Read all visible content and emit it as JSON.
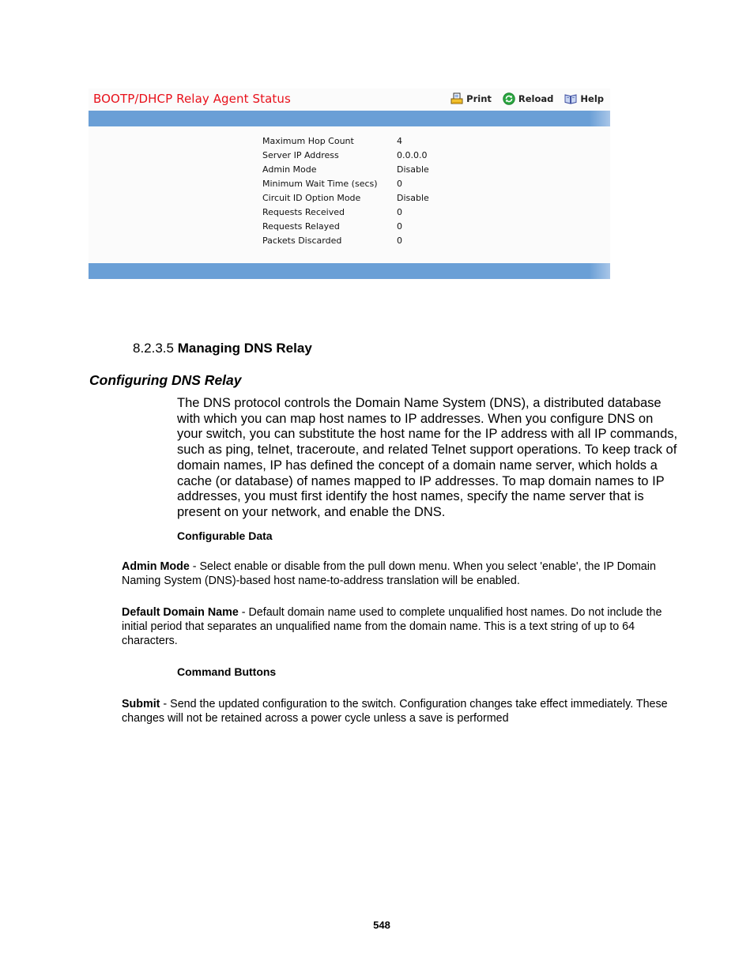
{
  "ui": {
    "title": "BOOTP/DHCP Relay Agent Status",
    "toolbar": {
      "print": {
        "label": "Print",
        "icon": "printer-icon"
      },
      "reload": {
        "label": "Reload",
        "icon": "reload-icon"
      },
      "help": {
        "label": "Help",
        "icon": "book-icon"
      }
    },
    "colors": {
      "title": "#e8101a",
      "bar": "#6a9fd6"
    },
    "rows": [
      {
        "label": "Maximum Hop Count",
        "value": "4"
      },
      {
        "label": "Server IP Address",
        "value": "0.0.0.0"
      },
      {
        "label": "Admin Mode",
        "value": "Disable"
      },
      {
        "label": "Minimum Wait Time (secs)",
        "value": "0"
      },
      {
        "label": "Circuit ID Option Mode",
        "value": "Disable"
      },
      {
        "label": "Requests Received",
        "value": "0"
      },
      {
        "label": "Requests Relayed",
        "value": "0"
      },
      {
        "label": "Packets Discarded",
        "value": "0"
      }
    ]
  },
  "doc": {
    "section_number": "8.2.3.5",
    "section_title": "Managing DNS Relay",
    "subsection_title": "Configuring DNS Relay",
    "intro": "The DNS protocol controls the Domain Name System (DNS), a distributed database with which you can map host names to IP addresses. When you configure DNS on your switch, you can substitute the host name for the IP address with all IP commands, such as ping, telnet, traceroute, and related Telnet support operations. To keep track of domain names, IP has defined the concept of a domain name server, which holds a cache (or database) of names mapped to IP addresses. To map domain names to IP addresses, you must first identify the host names, specify the name server that is present on your network, and enable the DNS.",
    "configurable_data_heading": "Configurable Data",
    "fields": [
      {
        "name": "Admin Mode",
        "text": " - Select enable or disable from the pull down menu. When you select 'enable', the IP Domain Naming System (DNS)-based host name-to-address translation will be enabled."
      },
      {
        "name": "Default Domain Name",
        "text": " - Default domain name used to complete unqualified host names. Do not include the initial period that separates an unqualified name from the domain name. This is a text string of up to 64 characters."
      }
    ],
    "command_buttons_heading": "Command Buttons",
    "buttons": [
      {
        "name": "Submit",
        "text": " - Send the updated configuration to the switch. Configuration changes take effect immediately. These changes will not be retained across a power cycle unless a save is performed"
      }
    ],
    "page_number": "548"
  }
}
